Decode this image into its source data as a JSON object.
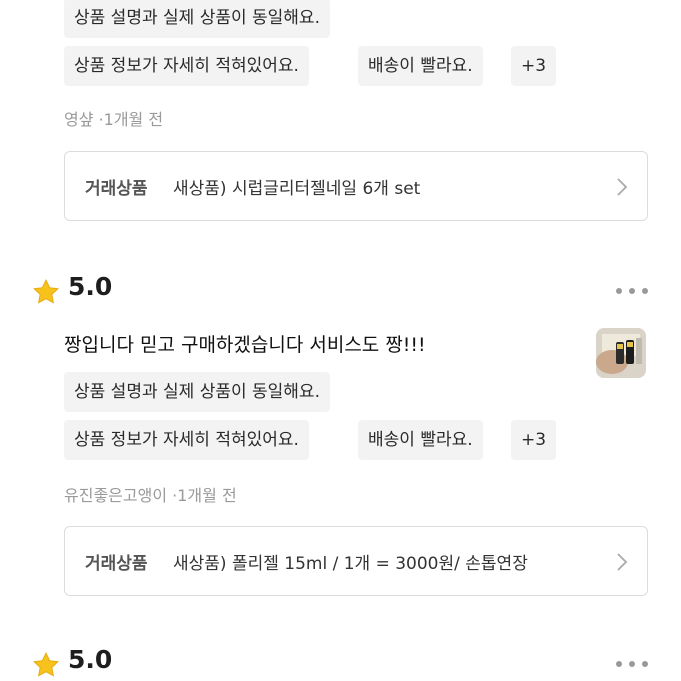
{
  "reviews": [
    {
      "tags": [
        "상품 설명과 실제 상품이 동일해요.",
        "상품 정보가 자세히 적혀있어요.",
        "배송이 빨라요.",
        "+3"
      ],
      "author": "영샾",
      "time": "1개월 전",
      "product_label": "거래상품",
      "product_name": "새상품) 시럽글리터젤네일 6개 set"
    },
    {
      "rating": "5.0",
      "text": "짱입니다 믿고 구매하겠습니다 서비스도 짱!!!",
      "tags": [
        "상품 설명과 실제 상품이 동일해요.",
        "상품 정보가 자세히 적혀있어요.",
        "배송이 빨라요.",
        "+3"
      ],
      "author": "유진좋은고앵이",
      "time": "1개월 전",
      "product_label": "거래상품",
      "product_name": "새상품) 폴리젤 15ml / 1개 = 3000원/ 손톱연장"
    },
    {
      "rating": "5.0"
    }
  ],
  "meta_separator": "·",
  "colors": {
    "star": "#f7c21b",
    "tag_bg": "#f3f3f3",
    "meta": "#9a9a9a"
  },
  "icons": {
    "star": "star-icon",
    "more": "more-dots-icon",
    "chevron": "chevron-right-icon"
  }
}
